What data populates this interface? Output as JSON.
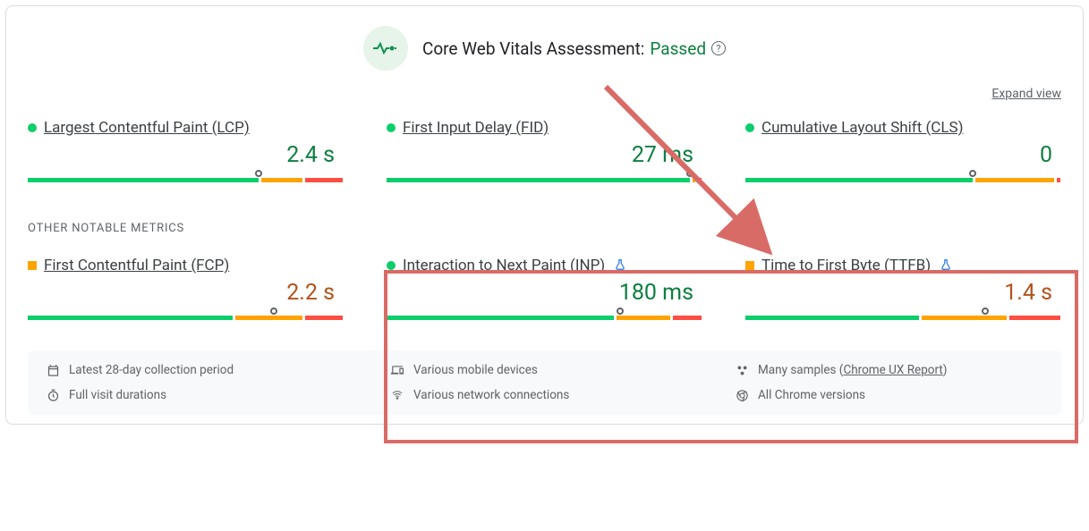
{
  "header": {
    "title_prefix": "Core Web Vitals Assessment:",
    "status": "Passed"
  },
  "expand_label": "Expand view",
  "section_label": "OTHER NOTABLE METRICS",
  "metrics": {
    "lcp": {
      "name": "Largest Contentful Paint (LCP)",
      "value": "2.4 s",
      "status": "green",
      "marker_pct": 73,
      "segs": [
        73,
        13,
        12
      ]
    },
    "fid": {
      "name": "First Input Delay (FID)",
      "value": "27 ms",
      "status": "green",
      "marker_pct": 96,
      "segs": [
        96,
        1,
        1
      ]
    },
    "cls": {
      "name": "Cumulative Layout Shift (CLS)",
      "value": "0",
      "status": "green",
      "marker_pct": 72,
      "segs": [
        72,
        25,
        1
      ]
    },
    "fcp": {
      "name": "First Contentful Paint (FCP)",
      "value": "2.2 s",
      "status": "orange",
      "marker_pct": 78,
      "segs": [
        65,
        21,
        12
      ]
    },
    "inp": {
      "name": "Interaction to Next Paint (INP)",
      "value": "180 ms",
      "status": "green",
      "marker_pct": 74,
      "segs": [
        72,
        17,
        9
      ],
      "experimental": true
    },
    "ttfb": {
      "name": "Time to First Byte (TTFB)",
      "value": "1.4 s",
      "status": "orange",
      "marker_pct": 76,
      "segs": [
        55,
        27,
        16
      ],
      "experimental": true
    }
  },
  "footer": {
    "period": "Latest 28-day collection period",
    "devices": "Various mobile devices",
    "samples_prefix": "Many samples (",
    "samples_link": "Chrome UX Report",
    "samples_suffix": ")",
    "durations": "Full visit durations",
    "network": "Various network connections",
    "versions": "All Chrome versions"
  },
  "chart_data": [
    {
      "type": "bar",
      "title": "Largest Contentful Paint (LCP)",
      "value": "2.4 s",
      "status": "good",
      "distribution_pct": {
        "good": 73,
        "needs_improvement": 13,
        "poor": 12
      }
    },
    {
      "type": "bar",
      "title": "First Input Delay (FID)",
      "value": "27 ms",
      "status": "good",
      "distribution_pct": {
        "good": 96,
        "needs_improvement": 1,
        "poor": 1
      }
    },
    {
      "type": "bar",
      "title": "Cumulative Layout Shift (CLS)",
      "value": "0",
      "status": "good",
      "distribution_pct": {
        "good": 72,
        "needs_improvement": 25,
        "poor": 1
      }
    },
    {
      "type": "bar",
      "title": "First Contentful Paint (FCP)",
      "value": "2.2 s",
      "status": "needs_improvement",
      "distribution_pct": {
        "good": 65,
        "needs_improvement": 21,
        "poor": 12
      }
    },
    {
      "type": "bar",
      "title": "Interaction to Next Paint (INP)",
      "value": "180 ms",
      "status": "good",
      "distribution_pct": {
        "good": 72,
        "needs_improvement": 17,
        "poor": 9
      }
    },
    {
      "type": "bar",
      "title": "Time to First Byte (TTFB)",
      "value": "1.4 s",
      "status": "needs_improvement",
      "distribution_pct": {
        "good": 55,
        "needs_improvement": 27,
        "poor": 16
      }
    }
  ]
}
